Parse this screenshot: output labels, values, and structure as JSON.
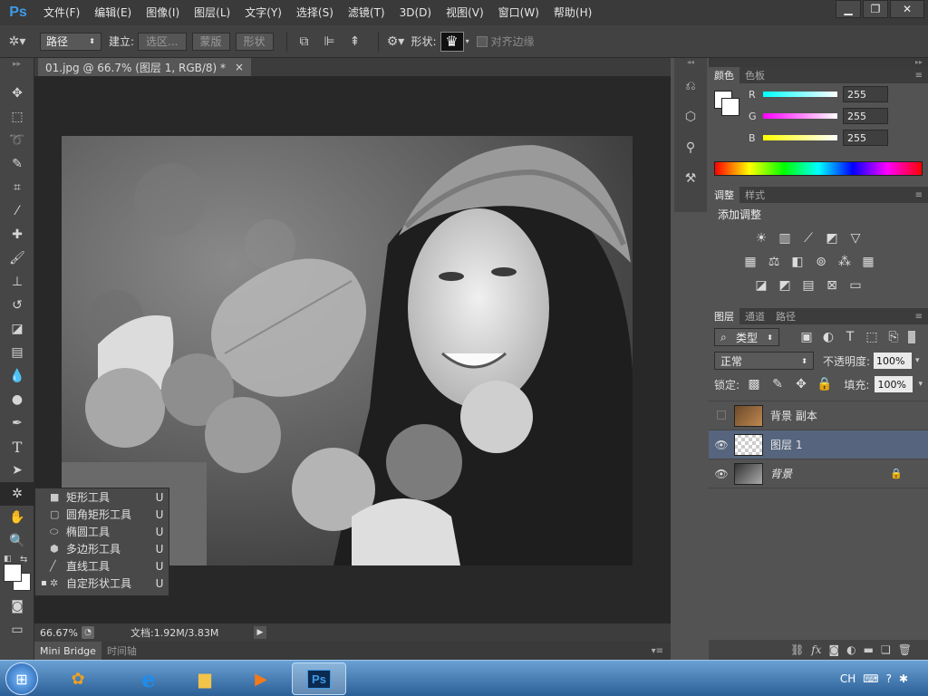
{
  "app": {
    "logo": "Ps"
  },
  "menu": [
    "文件(F)",
    "编辑(E)",
    "图像(I)",
    "图层(L)",
    "文字(Y)",
    "选择(S)",
    "滤镜(T)",
    "3D(D)",
    "视图(V)",
    "窗口(W)",
    "帮助(H)"
  ],
  "options": {
    "mode": "路径",
    "make_label": "建立:",
    "selection_btn": "选区...",
    "mask_btn": "蒙版",
    "shape_btn": "形状",
    "shape_label": "形状:",
    "align_edges": "对齐边缘"
  },
  "document": {
    "tab": "01.jpg @ 66.7% (图层 1, RGB/8) *",
    "close": "×"
  },
  "status": {
    "zoom": "66.67%",
    "doc_info": "文档:1.92M/3.83M"
  },
  "bottom_tabs": [
    "Mini Bridge",
    "时间轴"
  ],
  "flyout": [
    {
      "label": "矩形工具",
      "key": "U",
      "selected": false
    },
    {
      "label": "圆角矩形工具",
      "key": "U",
      "selected": false
    },
    {
      "label": "椭圆工具",
      "key": "U",
      "selected": false
    },
    {
      "label": "多边形工具",
      "key": "U",
      "selected": false
    },
    {
      "label": "直线工具",
      "key": "U",
      "selected": false
    },
    {
      "label": "自定形状工具",
      "key": "U",
      "selected": true
    }
  ],
  "color_panel": {
    "tabs": [
      "颜色",
      "色板"
    ],
    "channels": [
      {
        "label": "R",
        "value": "255",
        "gradient": [
          "#000000",
          "#00ffff"
        ]
      },
      {
        "label": "G",
        "value": "255",
        "gradient": [
          "#000000",
          "#ff00ff"
        ]
      },
      {
        "label": "B",
        "value": "255",
        "gradient": [
          "#000000",
          "#ffff00"
        ]
      }
    ]
  },
  "adjust_panel": {
    "tabs": [
      "调整",
      "样式"
    ],
    "title": "添加调整"
  },
  "layers_panel": {
    "tabs": [
      "图层",
      "通道",
      "路径"
    ],
    "filter": "类型",
    "blend": "正常",
    "opacity_label": "不透明度:",
    "opacity": "100%",
    "lock_label": "锁定:",
    "fill_label": "填充:",
    "fill": "100%",
    "layers": [
      {
        "name": "背景 副本",
        "visible": false,
        "selected": false,
        "locked": false
      },
      {
        "name": "图层 1",
        "visible": true,
        "selected": true,
        "locked": false
      },
      {
        "name": "背景",
        "visible": true,
        "selected": false,
        "locked": true
      }
    ]
  },
  "taskbar": {
    "input_method": "CH"
  }
}
